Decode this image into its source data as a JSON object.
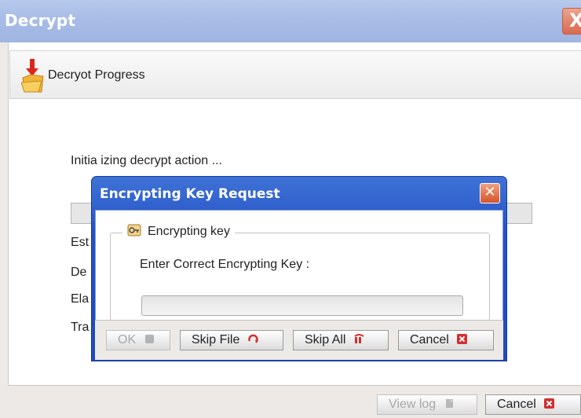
{
  "window": {
    "title": "Decrypt",
    "close_glyph": "X"
  },
  "progress": {
    "header_title": "Decryot Progress",
    "status_text": "Initia izing decrypt action ...",
    "stat_labels": [
      "Est",
      "De",
      "Ela",
      "Tra"
    ]
  },
  "footer": {
    "view_log_label": "View log",
    "cancel_label": "Cancel"
  },
  "modal": {
    "title": "Encrypting Key Request",
    "close_glyph": "✕",
    "group_label": "Encrypting key",
    "prompt": "Enter Correct Encrypting Key :",
    "key_value": "",
    "buttons": {
      "ok": "OK",
      "skip_file": "Skip File",
      "skip_all": "Skip All",
      "cancel": "Cancel"
    }
  },
  "colors": {
    "modal_title_bar": "#2453c6",
    "window_title_bar": "#a9bde6",
    "cancel_icon_red": "#d32f2f"
  },
  "icons": {
    "header": "folder-download-icon",
    "group": "key-icon",
    "ok": "ok-icon",
    "skip_file": "skip-file-icon",
    "skip_all": "skip-all-icon",
    "cancel": "cancel-x-icon",
    "view_log": "document-icon"
  }
}
